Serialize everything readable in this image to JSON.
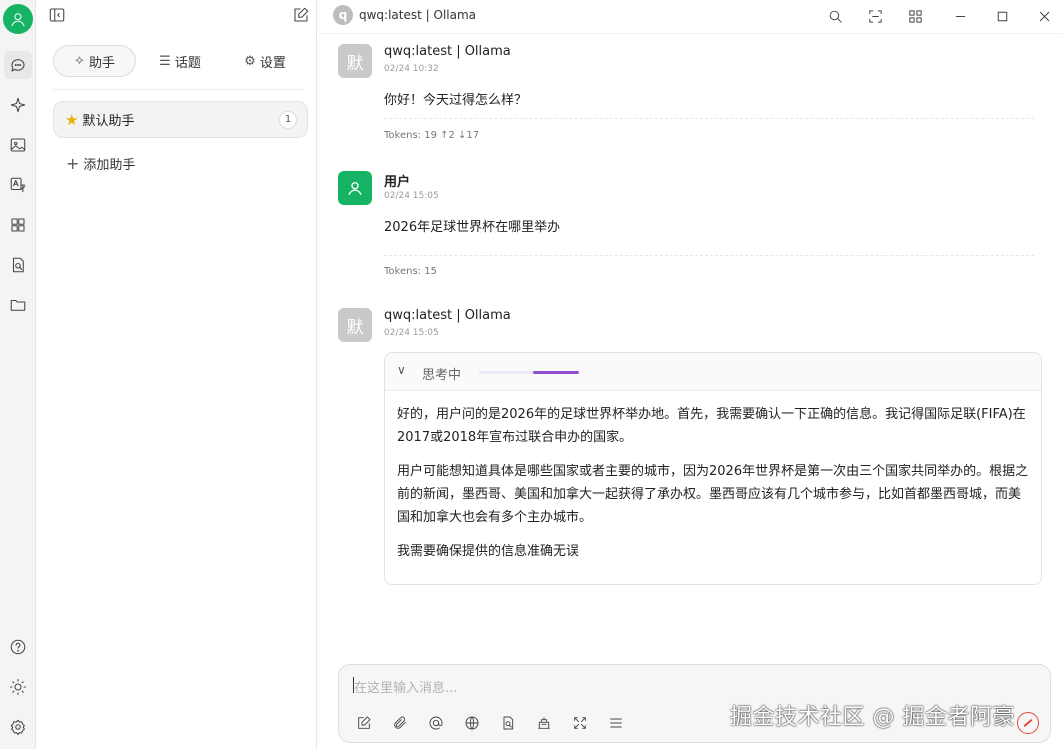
{
  "rail": {
    "icons": [
      "user-avatar-icon",
      "chat-icon",
      "sparkle-icon",
      "image-icon",
      "translate-icon",
      "apps-icon",
      "document-search-icon",
      "folder-icon",
      "help-icon",
      "theme-icon",
      "settings-gear-icon"
    ]
  },
  "sidebar": {
    "tabs": [
      {
        "label": "助手",
        "icon": "sparkle-icon",
        "active": true
      },
      {
        "label": "话题",
        "icon": "list-icon",
        "active": false
      },
      {
        "label": "设置",
        "icon": "gear-icon",
        "active": false
      }
    ],
    "assistant": {
      "label": "默认助手",
      "count": "1",
      "icon": "star-icon"
    },
    "add_label": "添加助手"
  },
  "topbar": {
    "model_initial": "q",
    "model_name": "qwq:latest | Ollama"
  },
  "messages": [
    {
      "avatar": "默",
      "name": "qwq:latest | Ollama",
      "time": "02/24 10:32",
      "text": "你好！今天过得怎么样？",
      "tokens": "Tokens: 19 ↑2 ↓17"
    },
    {
      "avatar": "user-icon",
      "name": "用户",
      "time": "02/24 15:05",
      "text": "2026年足球世界杯在哪里举办",
      "tokens": "Tokens: 15"
    },
    {
      "avatar": "默",
      "name": "qwq:latest | Ollama",
      "time": "02/24 15:05",
      "thinking": {
        "label": "思考中",
        "paragraphs": [
          "好的，用户问的是2026年的足球世界杯举办地。首先，我需要确认一下正确的信息。我记得国际足联(FIFA)在2017或2018年宣布过联合申办的国家。",
          "用户可能想知道具体是哪些国家或者主要的城市，因为2026年世界杯是第一次由三个国家共同举办的。根据之前的新闻，墨西哥、美国和加拿大一起获得了承办权。墨西哥应该有几个城市参与，比如首都墨西哥城，而美国和加拿大也会有多个主办城市。",
          "我需要确保提供的信息准确无误"
        ]
      }
    }
  ],
  "composer": {
    "placeholder": "在这里输入消息...",
    "tools": [
      "edit-icon",
      "attachment-icon",
      "at-icon",
      "globe-icon",
      "doc-search-icon",
      "knowledge-icon",
      "expand-icon",
      "divider-icon"
    ]
  },
  "watermark": "掘金技术社区 @ 掘金者阿豪",
  "colors": {
    "accent_green": "#16b364",
    "thinking_purple": "#8e4fd0",
    "send_red": "#e04a3c"
  }
}
